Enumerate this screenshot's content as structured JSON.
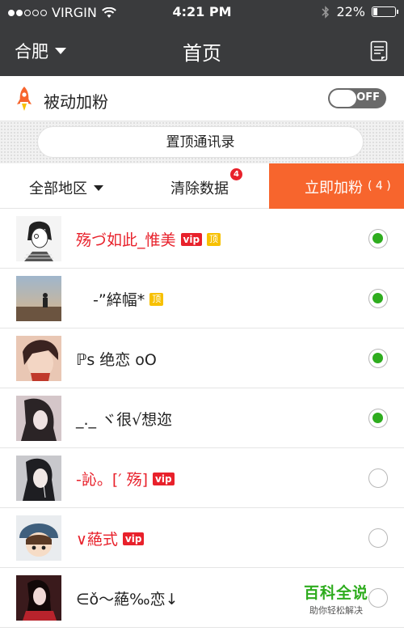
{
  "status_bar": {
    "carrier": "VIRGIN",
    "time": "4:21 PM",
    "battery": "22%",
    "battery_level": 0.22
  },
  "nav": {
    "city": "合肥",
    "title": "首页",
    "right_icon": "notepad-icon"
  },
  "passive": {
    "label": "被动加粉",
    "icon": "rocket-icon",
    "toggle_text": "OFF",
    "toggle_on": false
  },
  "pinned": {
    "button_label": "置顶通讯录"
  },
  "actions": {
    "region_label": "全部地区",
    "clear_label": "清除数据",
    "clear_badge": "4",
    "add_label": "立即加粉",
    "add_count": "( 4 )"
  },
  "colors": {
    "header_bg": "#3a3b3d",
    "accent_orange": "#f7652d",
    "vip_red": "#e8212b",
    "check_green": "#2eac1e",
    "top_badge_yellow": "#f7c000"
  },
  "contacts": [
    {
      "name": "殇づ如此_惟美",
      "vip": "vip",
      "top": "顶",
      "selected": true,
      "red": true
    },
    {
      "name": "-”綷幅*",
      "vip": "",
      "top": "顶",
      "selected": true,
      "red": false
    },
    {
      "name": "ℙs 绝恋 oO",
      "vip": "",
      "top": "",
      "selected": true,
      "red": false
    },
    {
      "name": "_._ ヾ很√想迩",
      "vip": "",
      "top": "",
      "selected": true,
      "red": false
    },
    {
      "name": "-訫。[′ 殇]",
      "vip": "vip",
      "top": "",
      "selected": false,
      "red": true
    },
    {
      "name": "∨蕝式",
      "vip": "vip",
      "top": "",
      "selected": false,
      "red": true
    },
    {
      "name": "∈ǒ～蕝‰恋↓",
      "vip": "",
      "top": "",
      "selected": false,
      "red": false
    }
  ],
  "watermark": {
    "title": "百科全说",
    "subtitle": "助你轻松解决"
  }
}
